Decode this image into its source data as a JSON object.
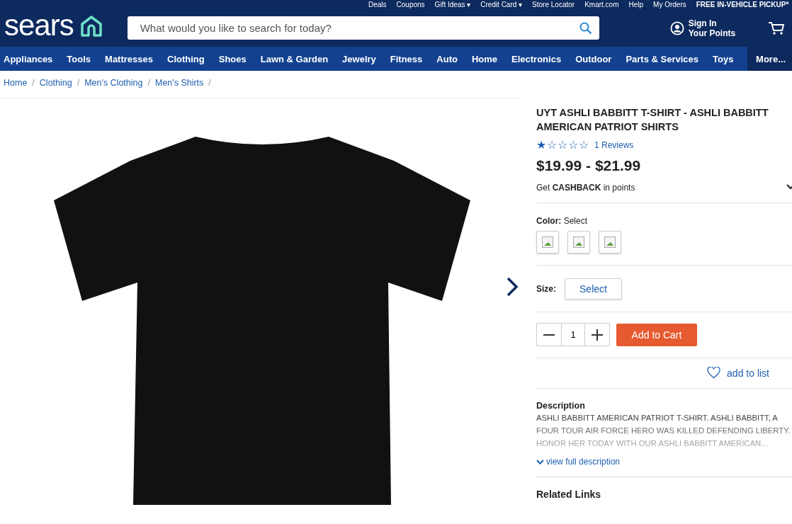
{
  "top_links": [
    "Deals",
    "Coupons",
    "Gift Ideas ▾",
    "Credit Card ▾",
    "Store Locator",
    "Kmart.com",
    "Help",
    "My Orders"
  ],
  "promo": "FREE IN-VEHICLE PICKUP*",
  "logo": "sears",
  "search": {
    "placeholder": "What would you like to search for today?"
  },
  "account": {
    "line1": "Sign In",
    "line2": "Your Points"
  },
  "nav": [
    {
      "label": "Appliances",
      "selected": false
    },
    {
      "label": "Tools",
      "selected": false
    },
    {
      "label": "Mattresses",
      "selected": false
    },
    {
      "label": "Clothing",
      "selected": false
    },
    {
      "label": "Shoes",
      "selected": false
    },
    {
      "label": "Lawn & Garden",
      "selected": false
    },
    {
      "label": "Jewelry",
      "selected": false
    },
    {
      "label": "Fitness",
      "selected": false
    },
    {
      "label": "Auto",
      "selected": false
    },
    {
      "label": "Home",
      "selected": false
    },
    {
      "label": "Electronics",
      "selected": false
    },
    {
      "label": "Outdoor",
      "selected": false
    },
    {
      "label": "Parts & Services",
      "selected": false
    },
    {
      "label": "Toys",
      "selected": false
    },
    {
      "label": "More...",
      "selected": true
    }
  ],
  "breadcrumbs": [
    {
      "label": "Home",
      "separator": "/"
    },
    {
      "label": "Clothing",
      "separator": "/"
    },
    {
      "label": "Men's Clothing",
      "separator": "/"
    },
    {
      "label": "Men's Shirts",
      "separator": "/"
    }
  ],
  "product": {
    "title": "UYT ASHLI BABBITT T-SHIRT - ASHLI BABBITT AMERICAN PATRIOT SHIRTS",
    "stars": 1,
    "reviews": "1 Reviews",
    "price": "$19.99 - $21.99",
    "cashback": "Get **CASHBACK** in points",
    "color_label": "Color:",
    "color_value": "Select",
    "swatches": [
      {
        "selected": false
      },
      {
        "selected": false
      },
      {
        "selected": false
      }
    ],
    "size_label": "Size:",
    "size_button": "Select",
    "quantity": "1",
    "add_to_cart": "Add to Cart",
    "add_to_list": "add to list",
    "description_heading": "Description",
    "description": "ASHLI BABBITT AMERICAN PATRIOT T-SHIRT. ASHLI BABBITT, A FOUR TOUR AIR FORCE HERO WAS KILLED DEFENDING LIBERTY. HONOR HER TODAY WITH OUR ASHLI BABBITT AMERICAN...",
    "view_full": "view full description",
    "related": "Related Links"
  }
}
